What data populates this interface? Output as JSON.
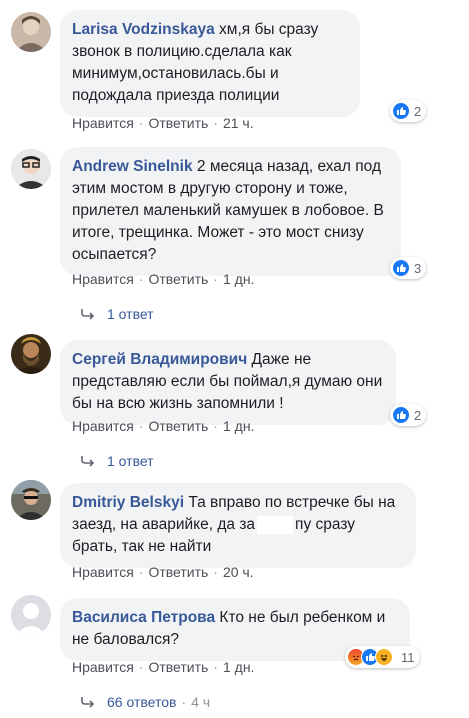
{
  "comments": [
    {
      "author": "Larisa Vodzinskaya",
      "text": "хм,я бы сразу звонок в полицию.сделала как минимум,остановилась.бы и подождала приезда полиции",
      "like_label": "Нравится",
      "reply_label": "Ответить",
      "time": "21 ч.",
      "reactions": {
        "icons": [
          "like-icon"
        ],
        "count": "2"
      }
    },
    {
      "author": "Andrew Sinelnik",
      "text": "2 месяца назад, ехал под этим мостом в другую сторону и тоже, прилетел маленький камушек в лобовое. В итоге, трещинка. Может - это мост снизу осыпается?",
      "like_label": "Нравится",
      "reply_label": "Ответить",
      "time": "1 дн.",
      "reactions": {
        "icons": [
          "like-icon"
        ],
        "count": "3"
      },
      "replies_label": "1 ответ"
    },
    {
      "author": "Сергей Владимирович",
      "text": "Даже не представляю если бы поймал,я думаю они бы на всю жизнь запомнили !",
      "like_label": "Нравится",
      "reply_label": "Ответить",
      "time": "1 дн.",
      "reactions": {
        "icons": [
          "like-icon"
        ],
        "count": "2"
      },
      "replies_label": "1 ответ"
    },
    {
      "author": "Dmitriy Belskyi",
      "text_before": "Та вправо по встречке бы на заезд, на аварийке, да за",
      "text_after": "пу сразу брать, так не найти",
      "like_label": "Нравится",
      "reply_label": "Ответить",
      "time": "20 ч."
    },
    {
      "author": "Василиса Петрова",
      "text": "Кто не был ребенком и не баловался?",
      "like_label": "Нравится",
      "reply_label": "Ответить",
      "time": "1 дн.",
      "reactions": {
        "icons": [
          "angry-icon",
          "like-icon",
          "haha-icon"
        ],
        "count": "11"
      },
      "replies_label": "66 ответов",
      "replies_time": "4 ч"
    }
  ],
  "colors": {
    "author": "#385898",
    "bubble": "#f2f3f5",
    "action_text": "#4b4f56",
    "like_blue": "#1877f2"
  }
}
